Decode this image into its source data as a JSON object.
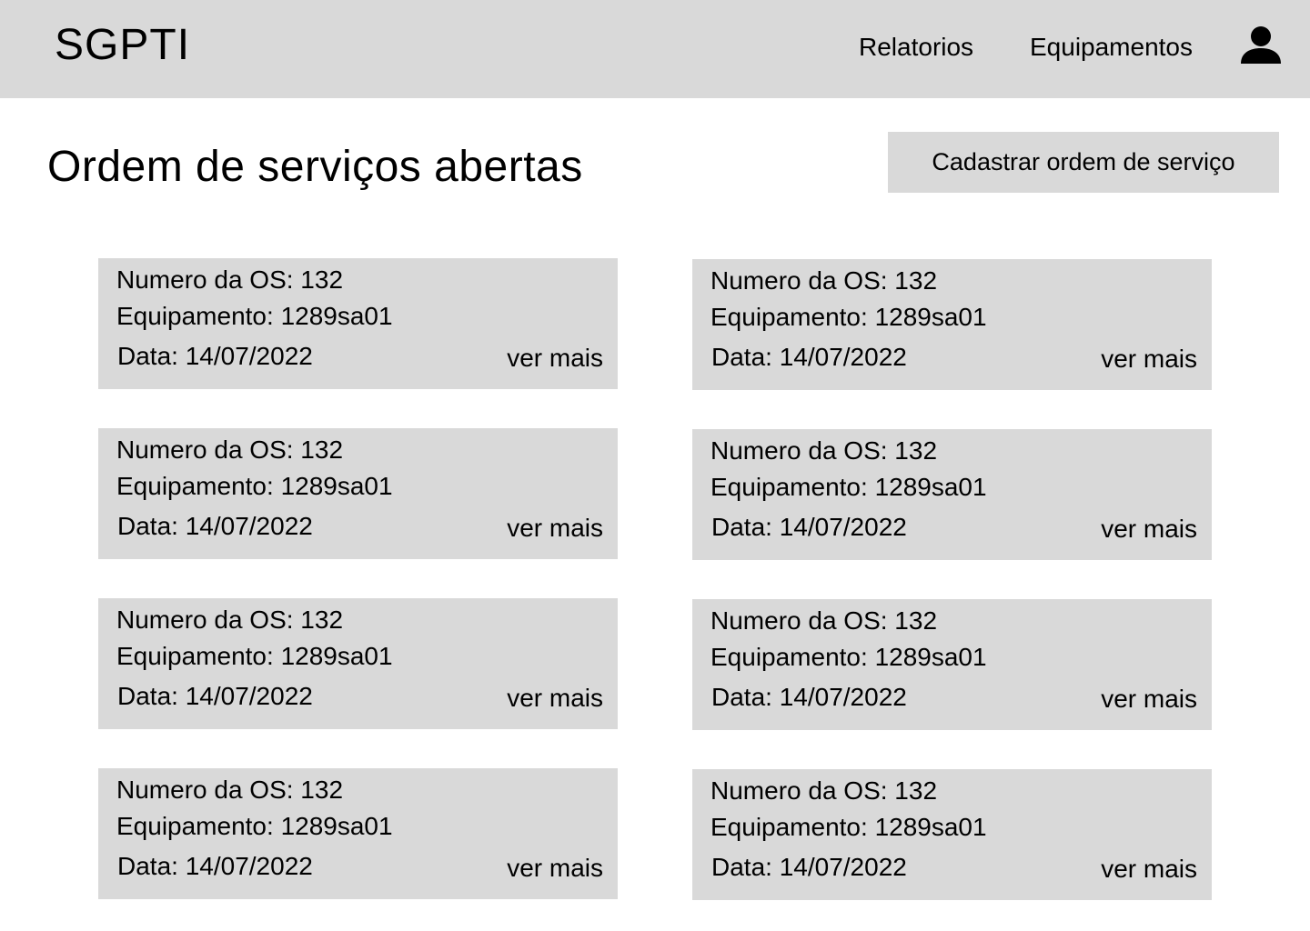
{
  "header": {
    "brand": "SGPTI",
    "nav": [
      {
        "label": "Relatorios"
      },
      {
        "label": "Equipamentos"
      }
    ],
    "user_icon": "user-icon"
  },
  "main": {
    "title": "Ordem de serviços abertas",
    "add_button_label": "Cadastrar ordem de serviço",
    "orders": [
      {
        "numero": "Numero da OS: 132",
        "equipamento": "Equipamento: 1289sa01",
        "data": "Data: 14/07/2022",
        "more": "ver mais"
      },
      {
        "numero": "Numero da OS: 132",
        "equipamento": "Equipamento: 1289sa01",
        "data": "Data: 14/07/2022",
        "more": "ver mais"
      },
      {
        "numero": "Numero da OS: 132",
        "equipamento": "Equipamento: 1289sa01",
        "data": "Data: 14/07/2022",
        "more": "ver mais"
      },
      {
        "numero": "Numero da OS: 132",
        "equipamento": "Equipamento: 1289sa01",
        "data": "Data: 14/07/2022",
        "more": "ver mais"
      },
      {
        "numero": "Numero da OS: 132",
        "equipamento": "Equipamento: 1289sa01",
        "data": "Data: 14/07/2022",
        "more": "ver mais"
      },
      {
        "numero": "Numero da OS: 132",
        "equipamento": "Equipamento: 1289sa01",
        "data": "Data: 14/07/2022",
        "more": "ver mais"
      },
      {
        "numero": "Numero da OS: 132",
        "equipamento": "Equipamento: 1289sa01",
        "data": "Data: 14/07/2022",
        "more": "ver mais"
      },
      {
        "numero": "Numero da OS: 132",
        "equipamento": "Equipamento: 1289sa01",
        "data": "Data: 14/07/2022",
        "more": "ver mais"
      }
    ]
  },
  "colors": {
    "surface": "#d9d9d9",
    "background": "#ffffff",
    "text": "#000000"
  }
}
